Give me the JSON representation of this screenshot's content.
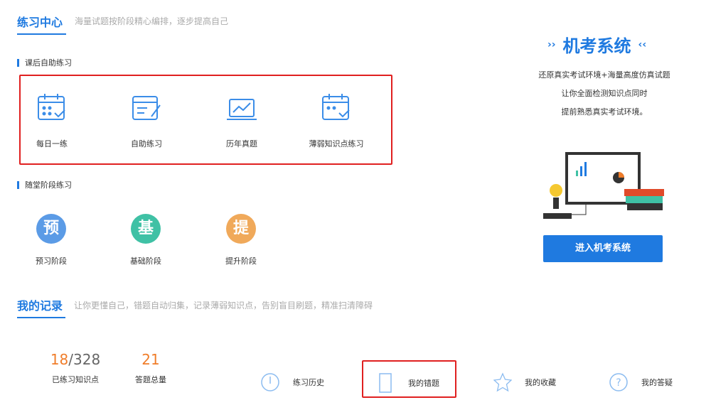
{
  "practice_center": {
    "title": "练习中心",
    "subtitle": "海量试题按阶段精心编排，逐步提高自己"
  },
  "after_class": {
    "title": "课后自助练习",
    "items": [
      {
        "label": "每日一练",
        "icon": "calendar-check-icon"
      },
      {
        "label": "自助练习",
        "icon": "notebook-pen-icon"
      },
      {
        "label": "历年真题",
        "icon": "laptop-chart-icon"
      },
      {
        "label": "薄弱知识点练习",
        "icon": "calendar-check-icon"
      }
    ]
  },
  "stage": {
    "title": "随堂阶段练习",
    "items": [
      {
        "glyph": "预",
        "label": "预习阶段",
        "color": "#5b9be6"
      },
      {
        "glyph": "基",
        "label": "基础阶段",
        "color": "#3fc1a5"
      },
      {
        "glyph": "提",
        "label": "提升阶段",
        "color": "#f0a95a"
      }
    ]
  },
  "exam": {
    "title": "机考系统",
    "lines": [
      "还原真实考试环境+海量高度仿真试题",
      "让你全面检测知识点同时",
      "提前熟悉真实考试环境。"
    ],
    "button": "进入机考系统"
  },
  "records": {
    "title": "我的记录",
    "subtitle": "让你更懂自己，错题自动归集，记录薄弱知识点，告别盲目刷题，精准扫清障碍",
    "stats": [
      {
        "value": "18",
        "total": "/328",
        "label": "已练习知识点"
      },
      {
        "value": "21",
        "label": "答题总量"
      }
    ],
    "links": [
      {
        "label": "练习历史",
        "icon": "clock-icon"
      },
      {
        "label": "我的错题",
        "icon": "document-icon"
      },
      {
        "label": "我的收藏",
        "icon": "star-icon"
      },
      {
        "label": "我的答疑",
        "icon": "question-icon"
      }
    ]
  },
  "colors": {
    "accent": "#1f7ae0",
    "orange": "#f07d2a",
    "highlight": "#e02020"
  }
}
